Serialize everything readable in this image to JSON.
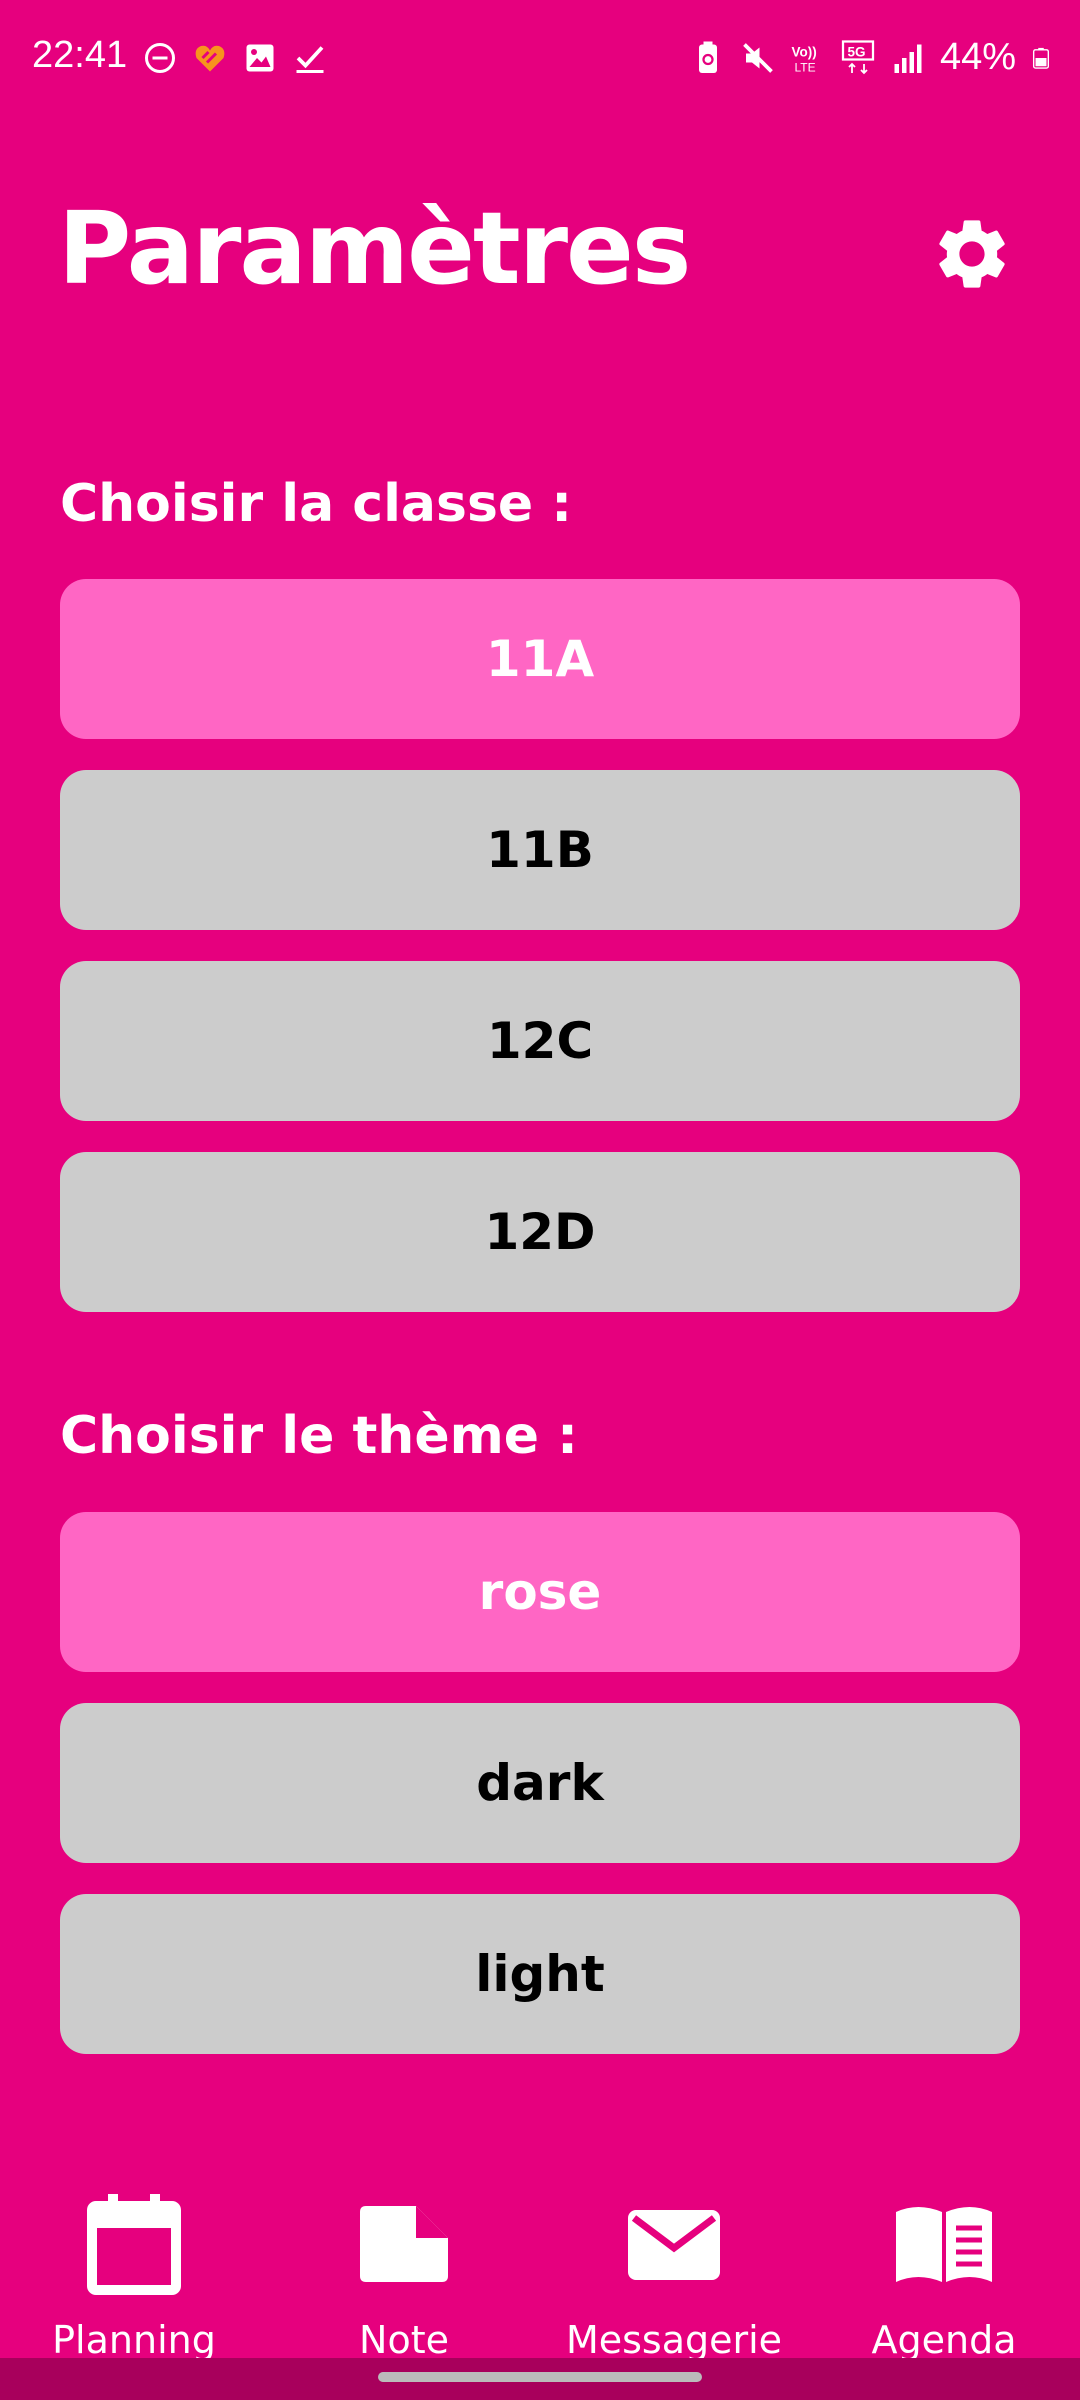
{
  "status_bar": {
    "time": "22:41",
    "battery": "44%",
    "left_icons": [
      "do-not-disturb-icon",
      "app-heart-icon",
      "gallery-icon",
      "check-icon"
    ],
    "right_icons": [
      "battery-saver-icon",
      "mute-icon",
      "volte-icon",
      "5g-icon",
      "signal-icon",
      "battery-icon"
    ]
  },
  "header": {
    "title": "Paramètres",
    "settings_icon": "gear-icon"
  },
  "class_section": {
    "label": "Choisir la classe :",
    "options": [
      "11A",
      "11B",
      "12C",
      "12D"
    ],
    "selected": "11A"
  },
  "theme_section": {
    "label": "Choisir le thème :",
    "options": [
      "rose",
      "dark",
      "light"
    ],
    "selected": "rose"
  },
  "bottom_nav": {
    "items": [
      {
        "label": "Planning",
        "icon": "calendar-icon"
      },
      {
        "label": "Note",
        "icon": "note-icon"
      },
      {
        "label": "Messagerie",
        "icon": "mail-icon"
      },
      {
        "label": "Agenda",
        "icon": "book-icon"
      }
    ]
  },
  "colors": {
    "background": "#E6007E",
    "selected": "#FF66C4",
    "unselected": "#CCCCCC"
  }
}
